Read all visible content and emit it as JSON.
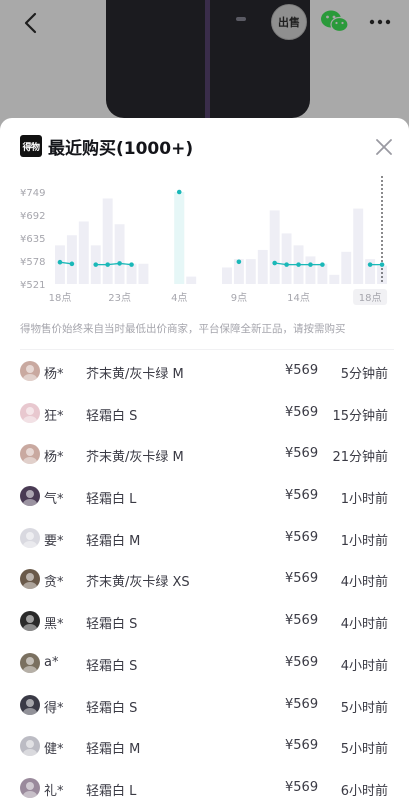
{
  "header": {
    "sell_label": "出售"
  },
  "sheet": {
    "brand_logo_text": "得物",
    "title": "最近购买(1000+)",
    "note": "得物售价始终来自当时最低出价商家，平台保障全新正品，请按需购买"
  },
  "chart_data": {
    "type": "bar+line",
    "y_ticks": [
      "¥749",
      "¥692",
      "¥635",
      "¥578",
      "¥521"
    ],
    "y_tick_values": [
      749,
      692,
      635,
      578,
      521
    ],
    "x_ticks": [
      "18点",
      "23点",
      "4点",
      "9点",
      "14点",
      "18点"
    ],
    "x_selected": "18点",
    "price_points": [
      {
        "slot": 0,
        "value": 575
      },
      {
        "slot": 1,
        "value": 571
      },
      {
        "slot": 3,
        "value": 569
      },
      {
        "slot": 4,
        "value": 569
      },
      {
        "slot": 5,
        "value": 572
      },
      {
        "slot": 6,
        "value": 569
      },
      {
        "slot": 10,
        "value": 749
      },
      {
        "slot": 15,
        "value": 576
      },
      {
        "slot": 18,
        "value": 573
      },
      {
        "slot": 19,
        "value": 569
      },
      {
        "slot": 20,
        "value": 569
      },
      {
        "slot": 21,
        "value": 569
      },
      {
        "slot": 22,
        "value": 569
      },
      {
        "slot": 26,
        "value": 569
      },
      {
        "slot": 27,
        "value": 569
      }
    ],
    "volume_levels": [
      0.42,
      0.53,
      0.68,
      0.42,
      0.93,
      0.65,
      0.22,
      0.22,
      0.0,
      0.0,
      1.0,
      0.08,
      0.0,
      0.0,
      0.18,
      0.27,
      0.27,
      0.37,
      0.8,
      0.55,
      0.42,
      0.3,
      0.22,
      0.1,
      0.35,
      0.82,
      0.27,
      0.2
    ],
    "highlight_slot": 10,
    "accent_color": "#1ab8b8",
    "bar_color": "#eeeef5"
  },
  "purchases": [
    {
      "user": "杨*",
      "variant": "芥末黄/灰卡绿 M",
      "price": "¥569",
      "time": "5分钟前",
      "avatar_color": "#c9a9a0"
    },
    {
      "user": "狂*",
      "variant": "轻霜白 S",
      "price": "¥569",
      "time": "15分钟前",
      "avatar_color": "#e8c8cf"
    },
    {
      "user": "杨*",
      "variant": "芥末黄/灰卡绿 M",
      "price": "¥569",
      "time": "21分钟前",
      "avatar_color": "#c9a9a0"
    },
    {
      "user": "气*",
      "variant": "轻霜白 L",
      "price": "¥569",
      "time": "1小时前",
      "avatar_color": "#4a3b54"
    },
    {
      "user": "要*",
      "variant": "轻霜白 M",
      "price": "¥569",
      "time": "1小时前",
      "avatar_color": "#d9d9e0"
    },
    {
      "user": "贪*",
      "variant": "芥末黄/灰卡绿 XS",
      "price": "¥569",
      "time": "4小时前",
      "avatar_color": "#6a5a4a"
    },
    {
      "user": "黑*",
      "variant": "轻霜白 S",
      "price": "¥569",
      "time": "4小时前",
      "avatar_color": "#2a2a2a"
    },
    {
      "user": "a*",
      "variant": "轻霜白 S",
      "price": "¥569",
      "time": "4小时前",
      "avatar_color": "#7a7060"
    },
    {
      "user": "得*",
      "variant": "轻霜白 S",
      "price": "¥569",
      "time": "5小时前",
      "avatar_color": "#3a3a46"
    },
    {
      "user": "健*",
      "variant": "轻霜白 M",
      "price": "¥569",
      "time": "5小时前",
      "avatar_color": "#bcbcc4"
    },
    {
      "user": "礼*",
      "variant": "轻霜白 L",
      "price": "¥569",
      "time": "6小时前",
      "avatar_color": "#9a8a9c"
    }
  ]
}
